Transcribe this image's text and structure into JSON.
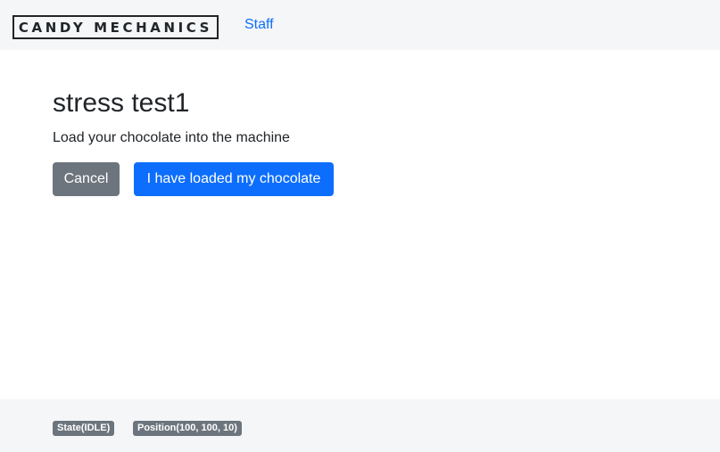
{
  "header": {
    "brand": "CANDY MECHANICS",
    "nav_links": [
      {
        "label": "Staff"
      }
    ]
  },
  "main": {
    "title": "stress test1",
    "instruction": "Load your chocolate into the machine",
    "cancel_label": "Cancel",
    "confirm_label": "I have loaded my chocolate"
  },
  "footer": {
    "state_badge": "State(IDLE)",
    "position_badge": "Position(100, 100, 10)"
  },
  "colors": {
    "primary": "#0d6efd",
    "secondary": "#6c757d",
    "navbar_bg": "#f5f6f7"
  }
}
